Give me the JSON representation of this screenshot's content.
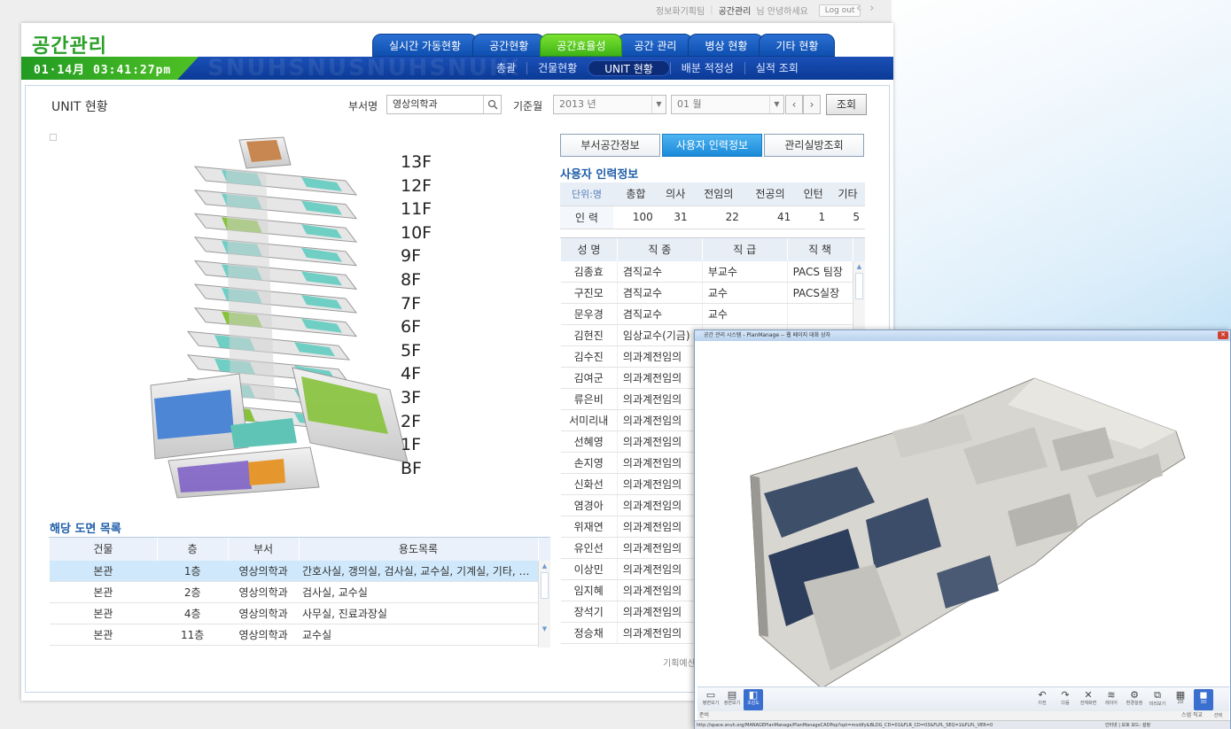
{
  "topbar": {
    "dept": "정보화기획팀",
    "user": "공간관리",
    "greeting": "님 안녕하세요",
    "logout": "Log out"
  },
  "app": {
    "logo": "공간관리",
    "clock": "01·14月 03:41:27pm",
    "watermark": "SNUHSNUSNUHSNUHSNUHSNUH"
  },
  "main_nav": [
    "실시간 가동현황",
    "공간현황",
    "공간효율성",
    "공간 관리",
    "병상 현황",
    "기타 현황"
  ],
  "main_nav_active": "공간효율성",
  "sub_nav": [
    "총괄",
    "건물현황",
    "UNIT 현황",
    "배분 적정성",
    "실적 조회"
  ],
  "sub_nav_active": "UNIT 현황",
  "page": {
    "title": "UNIT 현황",
    "dept_label": "부서명",
    "dept_value": "영상의학과",
    "month_label": "기준월",
    "year_value": "2013 년",
    "month_value": "01 월",
    "query_button": "조회"
  },
  "floors": [
    "13F",
    "12F",
    "11F",
    "10F",
    "9F",
    "8F",
    "7F",
    "6F",
    "5F",
    "4F",
    "3F",
    "2F",
    "1F",
    "BF"
  ],
  "tabs": [
    "부서공간정보",
    "사용자 인력정보",
    "관리실방조회"
  ],
  "tab_active": "사용자 인력정보",
  "staff_section_title": "사용자 인력정보",
  "summary": {
    "headers": [
      "단위:명",
      "총합",
      "의사",
      "전임의",
      "전공의",
      "인턴",
      "기타"
    ],
    "row": [
      "인 력",
      "100",
      "31",
      "22",
      "41",
      "1",
      "5"
    ]
  },
  "staff": {
    "headers": [
      "성 명",
      "직 종",
      "직 급",
      "직 책"
    ],
    "rows": [
      [
        "김종효",
        "겸직교수",
        "부교수",
        "PACS 팀장"
      ],
      [
        "구진모",
        "겸직교수",
        "교수",
        "PACS실장"
      ],
      [
        "문우경",
        "겸직교수",
        "교수",
        ""
      ],
      [
        "김현진",
        "임상교수(기금)",
        "",
        ""
      ],
      [
        "김수진",
        "의과계전임의",
        "",
        ""
      ],
      [
        "김여군",
        "의과계전임의",
        "",
        ""
      ],
      [
        "류은비",
        "의과계전임의",
        "",
        ""
      ],
      [
        "서미리내",
        "의과계전임의",
        "",
        ""
      ],
      [
        "선혜영",
        "의과계전임의",
        "",
        ""
      ],
      [
        "손지영",
        "의과계전임의",
        "",
        ""
      ],
      [
        "신화선",
        "의과계전임의",
        "",
        ""
      ],
      [
        "염경아",
        "의과계전임의",
        "",
        ""
      ],
      [
        "위재연",
        "의과계전임의",
        "",
        ""
      ],
      [
        "유인선",
        "의과계전임의",
        "",
        ""
      ],
      [
        "이상민",
        "의과계전임의",
        "",
        ""
      ],
      [
        "임지혜",
        "의과계전임의",
        "",
        ""
      ],
      [
        "장석기",
        "의과계전임의",
        "",
        ""
      ],
      [
        "정승채",
        "의과계전임의",
        "",
        ""
      ]
    ]
  },
  "drawings": {
    "title": "해당 도면 목록",
    "headers": [
      "건물",
      "층",
      "부서",
      "용도목록"
    ],
    "rows": [
      [
        "본관",
        "1층",
        "영상의학과",
        "간호사실, 갱의실, 검사실, 교수실, 기계실, 기타, 사무…"
      ],
      [
        "본관",
        "2층",
        "영상의학과",
        "검사실, 교수실"
      ],
      [
        "본관",
        "4층",
        "영상의학과",
        "사무실, 진료과장실"
      ],
      [
        "본관",
        "11층",
        "영상의학과",
        "교수실"
      ]
    ]
  },
  "footer_note": "기획예산",
  "popup": {
    "title": "공간 관리 시스템 - PlanManage -- 웹 페이지 대화 상자",
    "tools_left": [
      {
        "icon": "floor-view-icon",
        "label": "평면보기"
      },
      {
        "icon": "elevation-view-icon",
        "label": "정면보기"
      },
      {
        "icon": "birdseye-view-icon",
        "label": "조감도"
      }
    ],
    "tools_right": [
      {
        "icon": "undo-icon",
        "label": "이전"
      },
      {
        "icon": "redo-icon",
        "label": "다음"
      },
      {
        "icon": "fullscreen-icon",
        "label": "전체화면"
      },
      {
        "icon": "layers-icon",
        "label": "레이어"
      },
      {
        "icon": "settings-icon",
        "label": "환경설정"
      },
      {
        "icon": "preview-icon",
        "label": "미리보기"
      },
      {
        "icon": "view-2d-icon",
        "label": "2D"
      },
      {
        "icon": "view-3d-icon",
        "label": "3D"
      }
    ],
    "status_left": "준비",
    "status_mid": "스냅 직교",
    "status_right": "선택",
    "url": "http://space.snuh.org/MANAGEPlanManage/PlanManageCADPop?opt=modify&BLDG_CD=01&FLR_CD=03&FLPL_SEQ=1&FLPL_VER=0",
    "zone": "인터넷 | 보호 모드: 설정"
  },
  "colors": {
    "nav_blue": "#1a5fc4",
    "nav_green": "#4cc21f",
    "logo_green": "#2aa028",
    "tab_active": "#2b9be4",
    "selected_row": "#cfe8fb"
  }
}
